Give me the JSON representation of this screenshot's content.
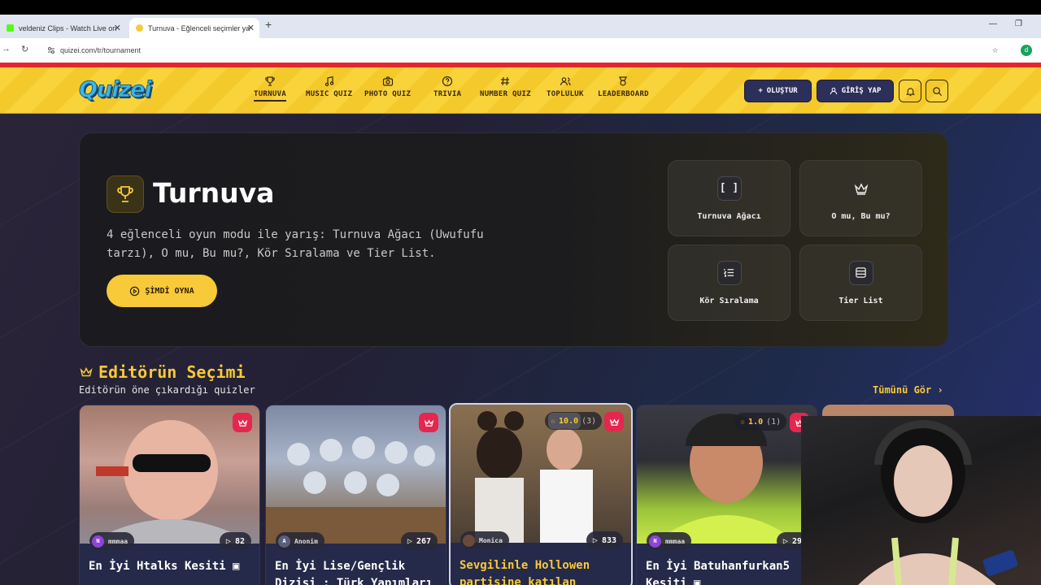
{
  "browser": {
    "tabs": [
      {
        "title": "veldeniz Clips - Watch Live on ",
        "favicon_color": "#53fc18",
        "active": false
      },
      {
        "title": "Turnuva - Eğlenceli seçimler ya",
        "favicon_color": "#f8c938",
        "active": true
      }
    ],
    "new_tab": "+",
    "url": "quizei.com/tr/tournament",
    "profile_initial": "d"
  },
  "header": {
    "logo": "Quizei",
    "nav": [
      {
        "label": "TURNUVA",
        "icon": "trophy-icon",
        "active": true
      },
      {
        "label": "MUSIC QUIZ",
        "icon": "music-icon",
        "active": false
      },
      {
        "label": "PHOTO QUIZ",
        "icon": "camera-icon",
        "active": false
      },
      {
        "label": "TRIVIA",
        "icon": "question-icon",
        "active": false
      },
      {
        "label": "NUMBER QUIZ",
        "icon": "hash-icon",
        "active": false
      },
      {
        "label": "TOPLULUK",
        "icon": "users-icon",
        "active": false
      },
      {
        "label": "LEADERBOARD",
        "icon": "medal-icon",
        "active": false
      }
    ],
    "create_label": "OLUŞTUR",
    "login_label": "GİRİŞ YAP"
  },
  "hero": {
    "title": "Turnuva",
    "description": "4 eğlenceli oyun modu ile yarış: Turnuva Ağacı (Uwufufu tarzı), O mu, Bu mu?, Kör Sıralama ve Tier List.",
    "play_label": "ŞİMDİ OYNA",
    "modes": [
      {
        "label": "Turnuva Ağacı",
        "icon": "bracket-icon"
      },
      {
        "label": "O mu, Bu mu?",
        "icon": "crown-icon"
      },
      {
        "label": "Kör Sıralama",
        "icon": "list-ordered-icon"
      },
      {
        "label": "Tier List",
        "icon": "tier-list-icon"
      }
    ]
  },
  "editors": {
    "title": "Editörün Seçimi",
    "subtitle": "Editörün öne çıkardığı quizler",
    "see_all": "Tümünü Gör",
    "cards": [
      {
        "author": "mmmaa",
        "author_initial": "N",
        "author_color": "#8e44d6",
        "plays": "82",
        "title": "En İyi Htalks Kesiti ▣",
        "rating": "",
        "rating_count": ""
      },
      {
        "author": "Anonim",
        "author_initial": "A",
        "author_color": "#5a5f7a",
        "plays": "267",
        "title": "En İyi Lise/Gençlik Dizisi : Türk Yapımları",
        "rating": "",
        "rating_count": ""
      },
      {
        "author": "Monica",
        "author_initial": "",
        "author_color": "#6b4a3a",
        "plays": "833",
        "title": "Sevgilinle Hollowen partisine katılan",
        "rating": "10.0",
        "rating_count": "(3)"
      },
      {
        "author": "mmmaa",
        "author_initial": "N",
        "author_color": "#8e44d6",
        "plays": "29",
        "title": "En İyi Batuhanfurkan5 Kesiti ▣",
        "rating": "1.0",
        "rating_count": "(1)"
      }
    ]
  },
  "colors": {
    "accent": "#f8c938",
    "crown_badge": "#e5264e",
    "header_bg": "#f8d33a",
    "nav_button": "#2b2f5a"
  }
}
